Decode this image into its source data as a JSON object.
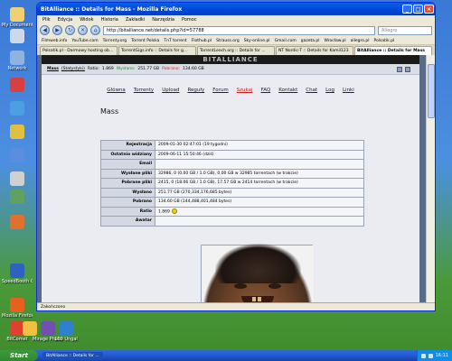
{
  "desktop_icons": [
    {
      "label": "My Documents",
      "color": "#f0d070"
    },
    {
      "label": "",
      "color": "#cfd8e6"
    },
    {
      "label": "Network",
      "color": "#8fb3e0"
    },
    {
      "label": "",
      "color": "#d84040"
    },
    {
      "label": "",
      "color": "#4aa0e0"
    },
    {
      "label": "",
      "color": "#e0c040"
    },
    {
      "label": "",
      "color": "#5a8ee0"
    },
    {
      "label": "",
      "color": "#d0d0d0"
    },
    {
      "label": "",
      "color": "#60a060"
    },
    {
      "label": "",
      "color": "#e07030"
    },
    {
      "label": "SpeedBooth Connection",
      "color": "#3060c0"
    },
    {
      "label": "Mozilla Firefox",
      "color": "#e86020"
    },
    {
      "label": "BitComet",
      "color": "#e04030"
    },
    {
      "label": "",
      "color": "#f0c040"
    },
    {
      "label": "Mirage Photo - Do...",
      "color": "#7050b0"
    },
    {
      "label": "100 Ungal",
      "color": "#3080d0"
    }
  ],
  "window": {
    "title": "BitAlliance :: Details for Mass - Mozilla Firefox",
    "menu": [
      "Plik",
      "Edycja",
      "Widok",
      "Historia",
      "Zakładki",
      "Narzędzia",
      "Pomoc"
    ],
    "url": "http://bitalliance.net/details.php?id=57788",
    "search_placeholder": "Allegro",
    "bookmarks": [
      "Filmweb.info",
      "YouTube.com",
      "Torrenty.org",
      "Torrent Polska",
      "TnT torrent",
      "Flothub.pl",
      "Strauss.org",
      "Sky-online.pl",
      "Gmail.com",
      "gazeta.pl",
      "Wrocław.pl",
      "allegro.pl",
      "Polsatik.pl"
    ],
    "tabs": [
      {
        "label": "Polsatik.pl - Darmowy hosting ob...",
        "active": false
      },
      {
        "label": "TorrentGigs.info :: Details for g...",
        "active": false
      },
      {
        "label": "TorrentLeech.org :: Details for ...",
        "active": false
      },
      {
        "label": "NT Nordic-T :: Details for Kamil123",
        "active": false
      },
      {
        "label": "BitAlliance :: Details for Mass",
        "active": true
      }
    ],
    "status": "Zakończono"
  },
  "site": {
    "banner": "BITALLIANCE",
    "user_line": {
      "user": "Mass",
      "extra": "(Statystyki)",
      "ratio_label": "Ratio:",
      "ratio": "1.869",
      "uploaded_label": "Wysłano:",
      "uploaded": "251.77 GB",
      "downloaded_label": "Pobrano:",
      "downloaded": "134.60 GB"
    },
    "nav": [
      {
        "label": "Główna",
        "active": false
      },
      {
        "label": "Torrenty",
        "active": false
      },
      {
        "label": "Upload",
        "active": false
      },
      {
        "label": "Reguły",
        "active": false
      },
      {
        "label": "Forum",
        "active": false
      },
      {
        "label": "Szukaj",
        "active": true
      },
      {
        "label": "FAQ",
        "active": false
      },
      {
        "label": "Kontakt",
        "active": false
      },
      {
        "label": "Chat",
        "active": false
      },
      {
        "label": "Log",
        "active": false
      },
      {
        "label": "Linki",
        "active": false
      }
    ],
    "heading": "Mass",
    "details": [
      {
        "key": "Rejestracja",
        "value": "2009-01-30 02:47:01 (19 tygodni)"
      },
      {
        "key": "Ostatnio widziany",
        "value": "2009-06-11 15:50:46 (dziś)"
      },
      {
        "key": "Email",
        "value": ""
      },
      {
        "key": "Wysłane pliki",
        "value": "32986, 0 (0.00 GB / 1.0 GB), 0.00 GB w 32985 torrentach (w trakcie)"
      },
      {
        "key": "Pobrane pliki",
        "value": "2415, 0 (18.06 GB / 1.0 GB), 17.57 GB w 2414 torrentach (w trakcie)"
      },
      {
        "key": "Wysłano",
        "value": "251.77 GB (270,334,176,685 bytes)"
      },
      {
        "key": "Pobrano",
        "value": "134.60 GB (144,488,401,484 bytes)"
      },
      {
        "key": "Ratio",
        "value": "1.869"
      },
      {
        "key": "Awatar",
        "value": ""
      }
    ]
  },
  "taskbar": {
    "start_label": "Start",
    "task_label": "BitAlliance :: Details for ...",
    "clock": "16:11"
  }
}
